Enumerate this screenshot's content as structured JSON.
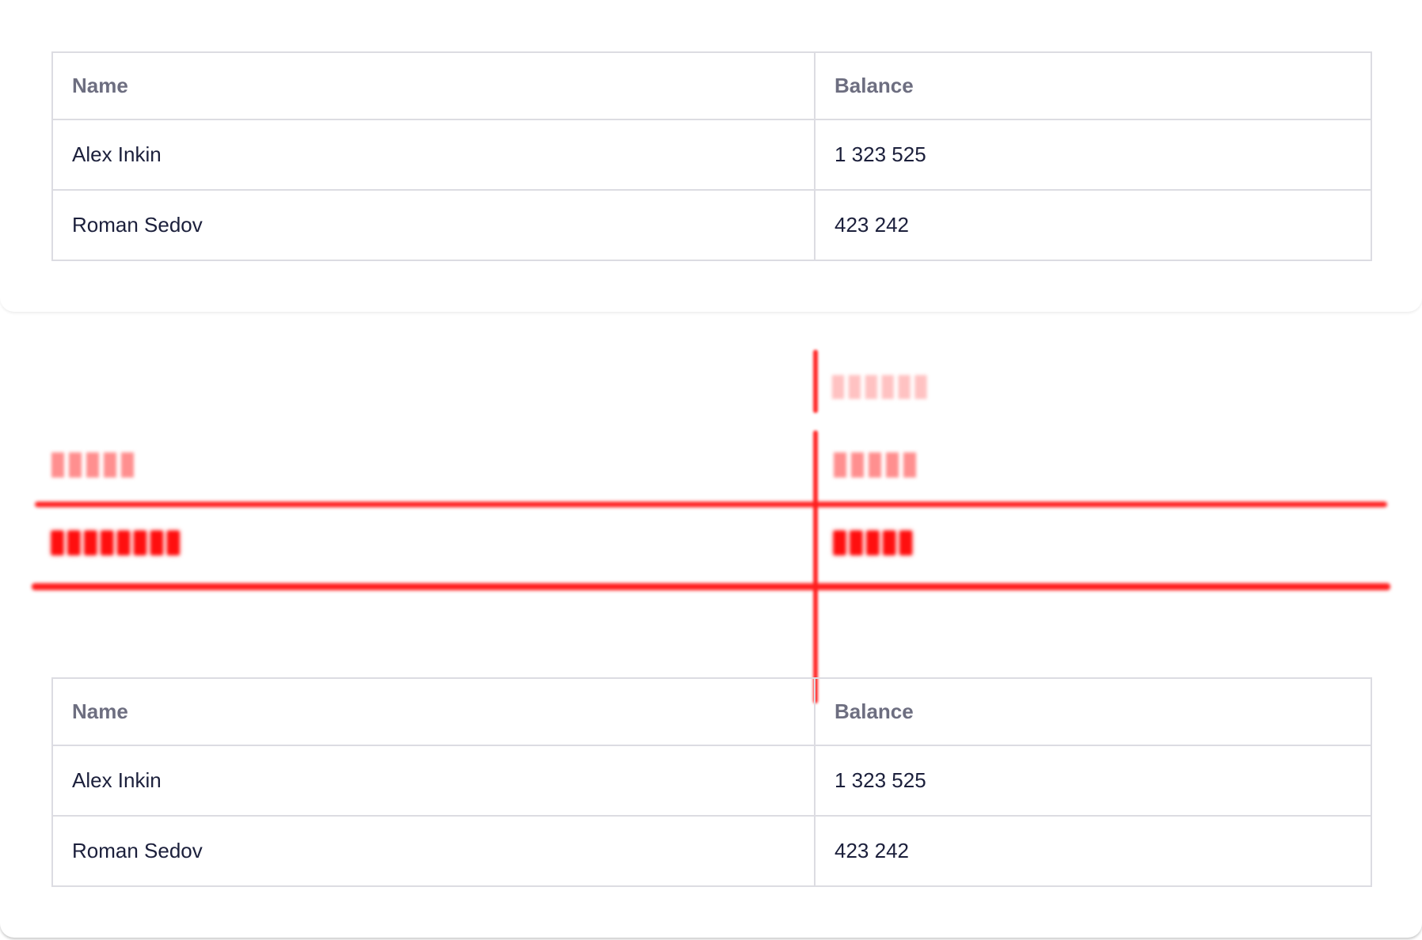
{
  "tables": {
    "top": {
      "headers": {
        "name": "Name",
        "balance": "Balance"
      },
      "rows": [
        {
          "name": "Alex Inkin",
          "balance": "1 323 525"
        },
        {
          "name": "Roman Sedov",
          "balance": "423 242"
        }
      ]
    },
    "bottom": {
      "headers": {
        "name": "Name",
        "balance": "Balance"
      },
      "rows": [
        {
          "name": "Alex Inkin",
          "balance": "1 323 525"
        },
        {
          "name": "Roman Sedov",
          "balance": "423 242"
        }
      ]
    }
  },
  "colors": {
    "border": "#dcdce2",
    "header_text": "#6d6e80",
    "cell_text": "#1b1f3b",
    "diff_highlight": "#ff1e1e"
  }
}
